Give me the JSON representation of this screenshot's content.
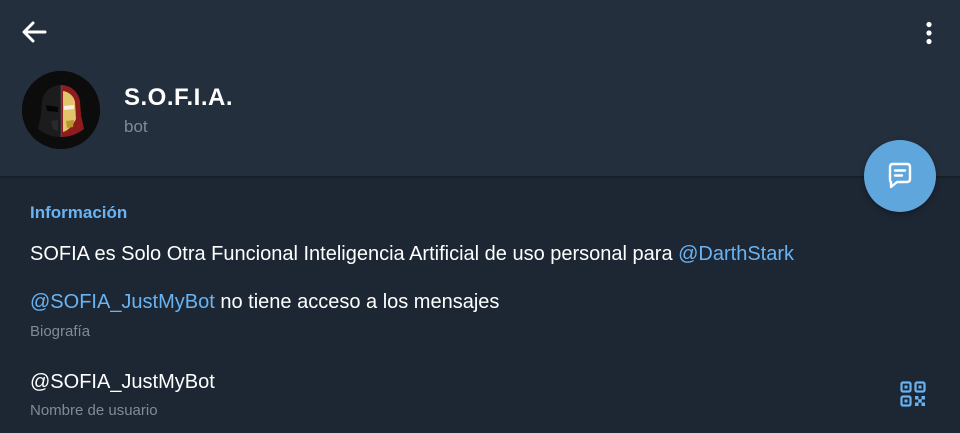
{
  "colors": {
    "background": "#1d2733",
    "header": "#242f3d",
    "accent": "#6ab3f3",
    "fab": "#5fa6dd",
    "secondary_text": "#7f8b98"
  },
  "header": {
    "back_icon": "arrow-left-icon",
    "menu_icon": "more-vertical-icon"
  },
  "profile": {
    "avatar": "iron-man-darth-vader-split-helmet",
    "name": "S.O.F.I.A.",
    "status": "bot"
  },
  "fab": {
    "icon": "message-icon"
  },
  "info": {
    "section_title": "Información",
    "bio_line1_text": "SOFIA es Solo Otra Funcional Inteligencia Artificial de uso personal para ",
    "bio_line1_mention": "@DarthStark",
    "bio_line2_mention": "@SOFIA_JustMyBot",
    "bio_line2_text": " no tiene acceso a los mensajes",
    "bio_caption": "Biografía",
    "username": "@SOFIA_JustMyBot",
    "username_caption": "Nombre de usuario",
    "qr_icon": "qr-code-icon"
  }
}
